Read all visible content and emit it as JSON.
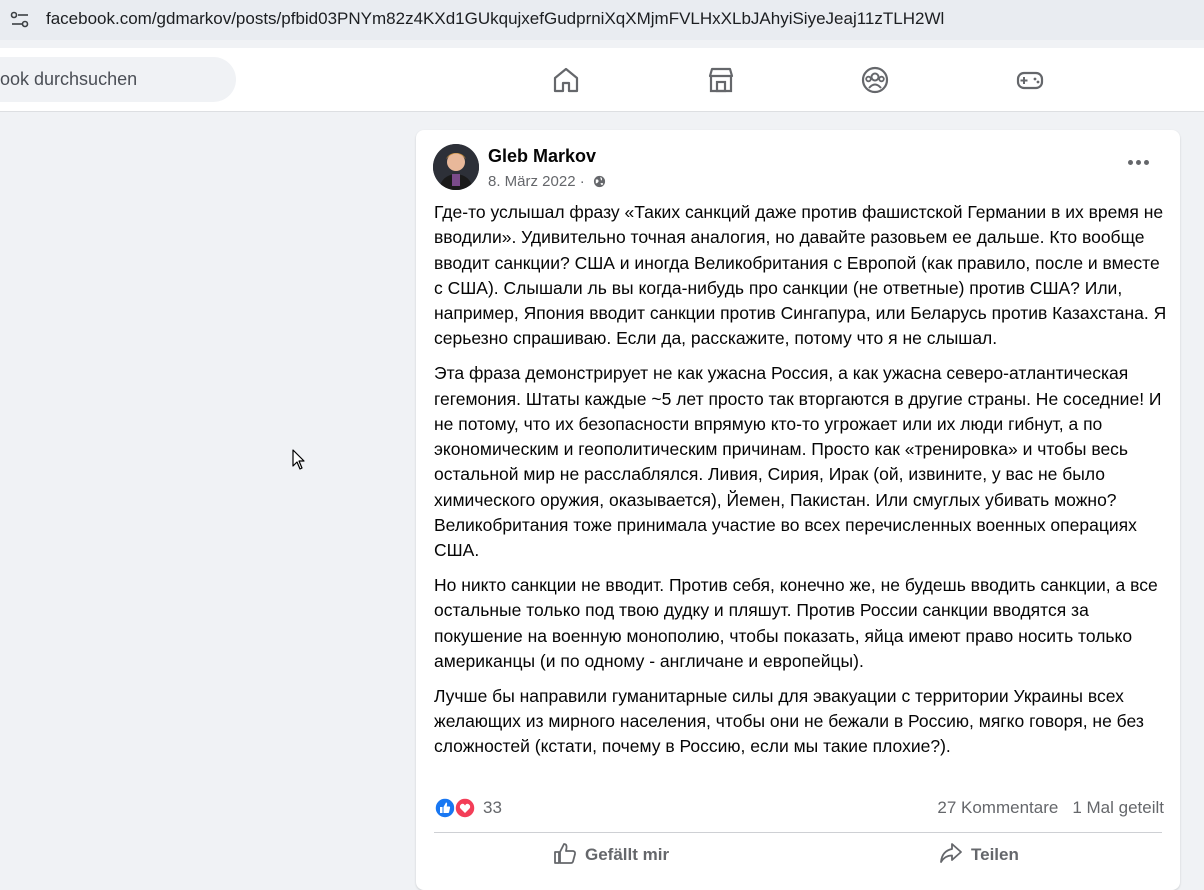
{
  "browser": {
    "url": "facebook.com/gdmarkov/posts/pfbid03PNYm82z4KXd1GUkqujxefGudprniXqXMjmFVLHxXLbJAhyiSiyeJeaj11zTLH2Wl"
  },
  "topbar": {
    "search_placeholder": "book durchsuchen",
    "nav": [
      "home-icon",
      "marketplace-icon",
      "groups-icon",
      "gaming-icon"
    ]
  },
  "post": {
    "author": "Gleb Markov",
    "date": "8. März 2022",
    "separator": "·",
    "paragraphs": [
      "Где-то услышал фразу «Таких санкций даже против фашистской Германии в их время не вводили». Удивительно точная аналогия, но давайте разовьем ее дальше. Кто вообще вводит санкции? США и иногда Великобритания с Европой (как правило, после и вместе с США). Слышали ль вы когда-нибудь про санкции (не ответные) против США? Или, например, Япония вводит санкции против Сингапура, или Беларусь против Казахстана. Я серьезно спрашиваю. Если да, расскажите, потому что я не слышал.",
      "Эта фраза демонстрирует не как ужасна Россия, а как ужасна северо-атлантическая гегемония. Штаты каждые ~5 лет просто так вторгаются в другие страны. Не соседние! И не потому, что их безопасности впрямую кто-то угрожает или их люди гибнут, а по экономическим и геополитическим причинам. Просто как «тренировка» и чтобы весь остальной мир не расслаблялся. Ливия, Сирия, Ирак (ой, извините, у вас не было химического оружия, оказывается), Йемен, Пакистан. Или смуглых убивать можно? Великобритания тоже принимала участие во всех перечисленных военных операциях США.",
      "Но никто санкции не вводит. Против себя, конечно же, не будешь вводить санкции, а все остальные только под твою дудку и пляшут. Против России санкции вводятся за покушение на военную монополию, чтобы показать, яйца имеют право носить только американцы (и по одному - англичане и европейцы).",
      "Лучше бы направили гуманитарные силы для эвакуации с территории Украины всех желающих из мирного населения, чтобы они не бежали в Россию, мягко говоря, не без сложностей (кстати, почему в Россию, если мы такие плохие?)."
    ],
    "reaction_count": "33",
    "comments": "27 Kommentare",
    "shares": "1 Mal geteilt",
    "actions": {
      "like": "Gefällt mir",
      "share": "Teilen"
    }
  },
  "colors": {
    "like_blue": "#1877f2",
    "love_red": "#f33e58",
    "meta_gray": "#65676b"
  }
}
